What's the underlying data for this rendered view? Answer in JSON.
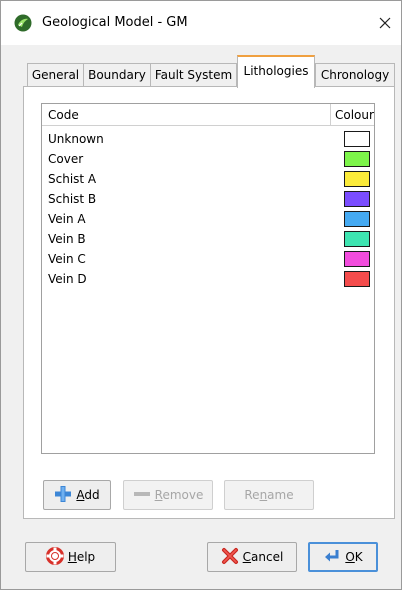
{
  "window": {
    "title": "Geological Model - GM"
  },
  "tabs": [
    {
      "label": "General",
      "active": false
    },
    {
      "label": "Boundary",
      "active": false
    },
    {
      "label": "Fault System",
      "active": false
    },
    {
      "label": "Lithologies",
      "active": true
    },
    {
      "label": "Chronology",
      "active": false
    }
  ],
  "table": {
    "columns": [
      "Code",
      "Colour"
    ],
    "rows": [
      {
        "code": "Unknown",
        "colour": "#ffffff"
      },
      {
        "code": "Cover",
        "colour": "#7df54a"
      },
      {
        "code": "Schist A",
        "colour": "#fbeb3a"
      },
      {
        "code": "Schist B",
        "colour": "#7a4dff"
      },
      {
        "code": "Vein A",
        "colour": "#45aaf2"
      },
      {
        "code": "Vein B",
        "colour": "#3ee5b1"
      },
      {
        "code": "Vein C",
        "colour": "#f24cdd"
      },
      {
        "code": "Vein D",
        "colour": "#f44c4c"
      }
    ]
  },
  "list_buttons": {
    "add": {
      "first": "A",
      "rest": "dd",
      "enabled": true
    },
    "remove": {
      "first": "R",
      "rest": "emove",
      "enabled": false
    },
    "rename": {
      "pre": "Re",
      "mid": "n",
      "post": "ame",
      "enabled": false
    }
  },
  "footer": {
    "help": {
      "first": "H",
      "rest": "elp"
    },
    "cancel": {
      "first": "C",
      "rest": "ancel"
    },
    "ok": {
      "first": "O",
      "rest": "K"
    }
  },
  "icons": {
    "app": "leapfrog-icon",
    "close": "close-icon",
    "add": "plus-icon",
    "remove": "minus-icon",
    "help": "lifebuoy-icon",
    "cancel": "red-x-icon",
    "ok": "enter-arrow-icon"
  }
}
